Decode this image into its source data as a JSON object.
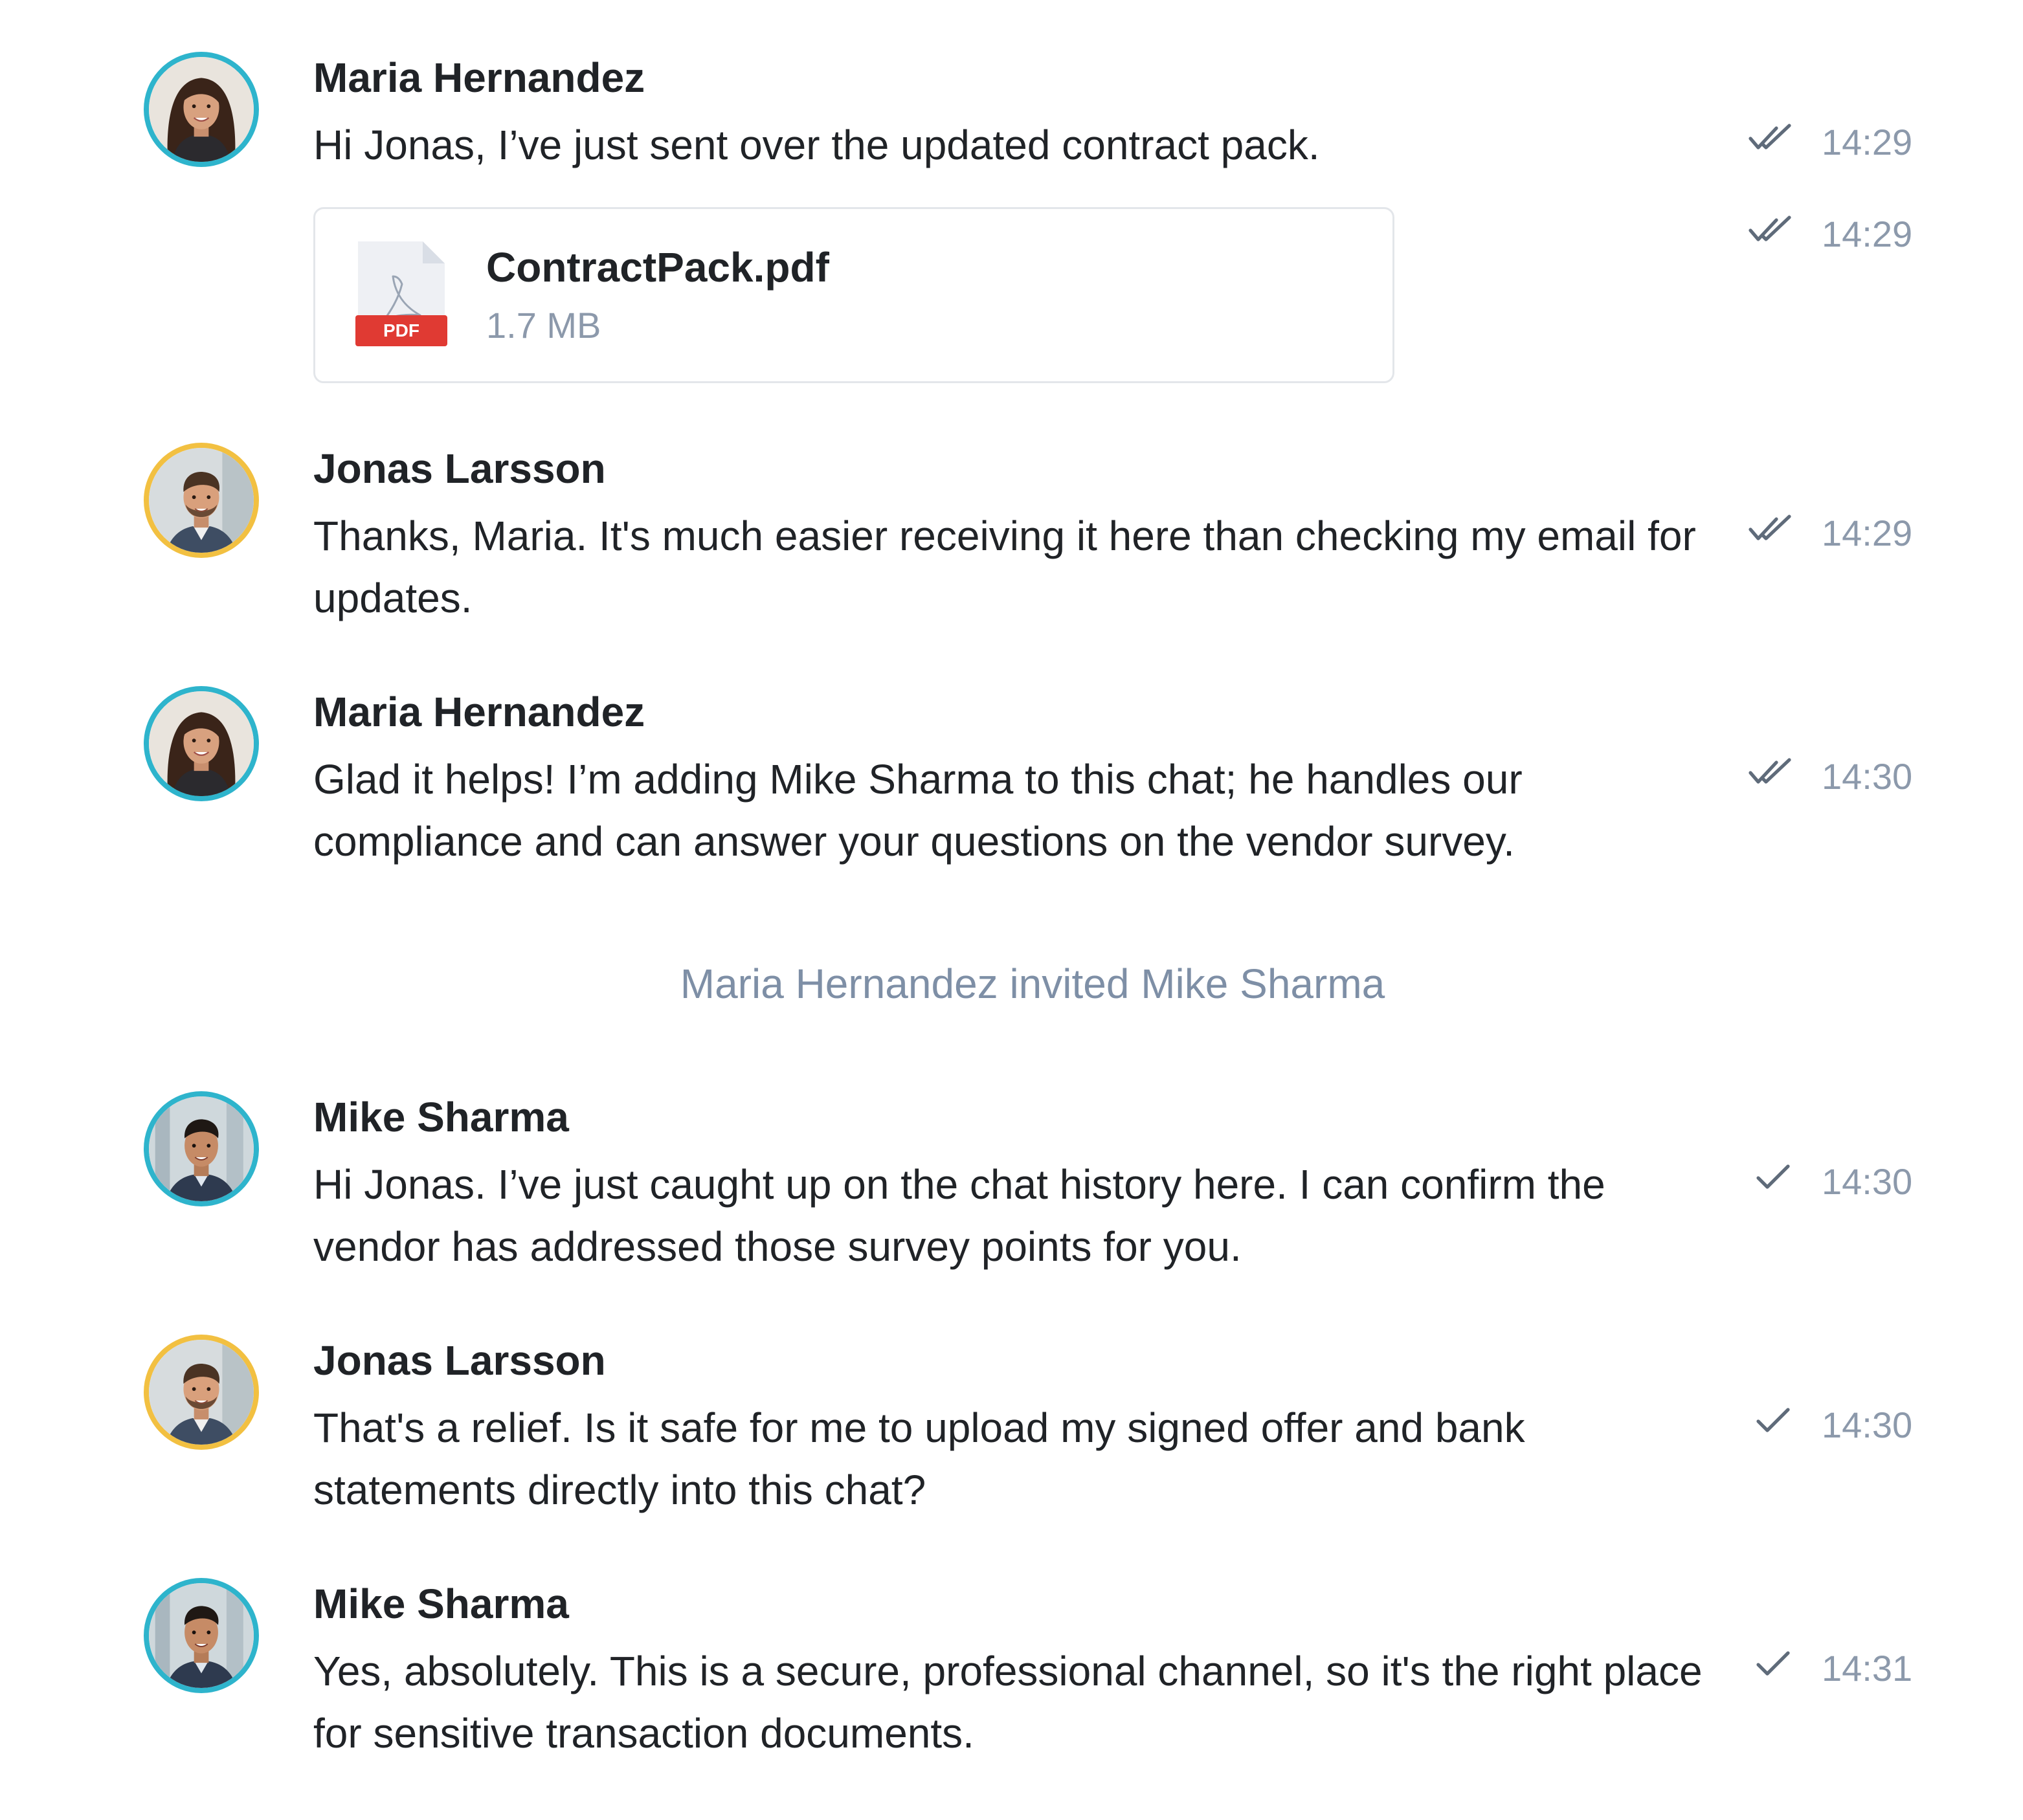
{
  "colors": {
    "ring_teal": "#2eb4cc",
    "ring_gold": "#f2c041",
    "muted_text": "#8c99ab",
    "system_text": "#7e8fa6",
    "pdf_red": "#e03a33"
  },
  "messages": [
    {
      "author": "Maria Hernandez",
      "avatar_icon": "avatar-woman-icon",
      "text": "Hi Jonas, I’ve just sent over the updated contract pack.",
      "time": "14:29",
      "status": "read"
    },
    {
      "attachment": {
        "file_name": "ContractPack.pdf",
        "file_size": "1.7 MB",
        "badge": "PDF",
        "icon": "pdf-file-icon"
      },
      "time": "14:29",
      "status": "read"
    },
    {
      "author": "Jonas Larsson",
      "avatar_icon": "avatar-man-icon",
      "text": "Thanks, Maria. It's much easier receiving it here than checking my email for updates.",
      "time": "14:29",
      "status": "read"
    },
    {
      "author": "Maria Hernandez",
      "avatar_icon": "avatar-woman-icon",
      "text": "Glad it helps! I’m adding Mike Sharma to this chat; he handles our compliance and can answer your questions on the vendor survey.",
      "time": "14:30",
      "status": "read"
    },
    {
      "author": "Mike Sharma",
      "avatar_icon": "avatar-man-icon",
      "text": "Hi Jonas. I’ve just caught up on the chat history here. I can confirm the vendor has addressed those survey points for you.",
      "time": "14:30",
      "status": "sent"
    },
    {
      "author": "Jonas Larsson",
      "avatar_icon": "avatar-man-icon",
      "text": "That's a relief. Is it safe for me to upload my signed offer and bank statements directly into this chat?",
      "time": "14:30",
      "status": "sent"
    },
    {
      "author": "Mike Sharma",
      "avatar_icon": "avatar-man-icon",
      "text": "Yes, absolutely. This is a secure, professional channel, so it's the right place for sensitive transaction documents.",
      "time": "14:31",
      "status": "sent"
    }
  ],
  "system_event": {
    "text": "Maria Hernandez invited Mike Sharma"
  }
}
